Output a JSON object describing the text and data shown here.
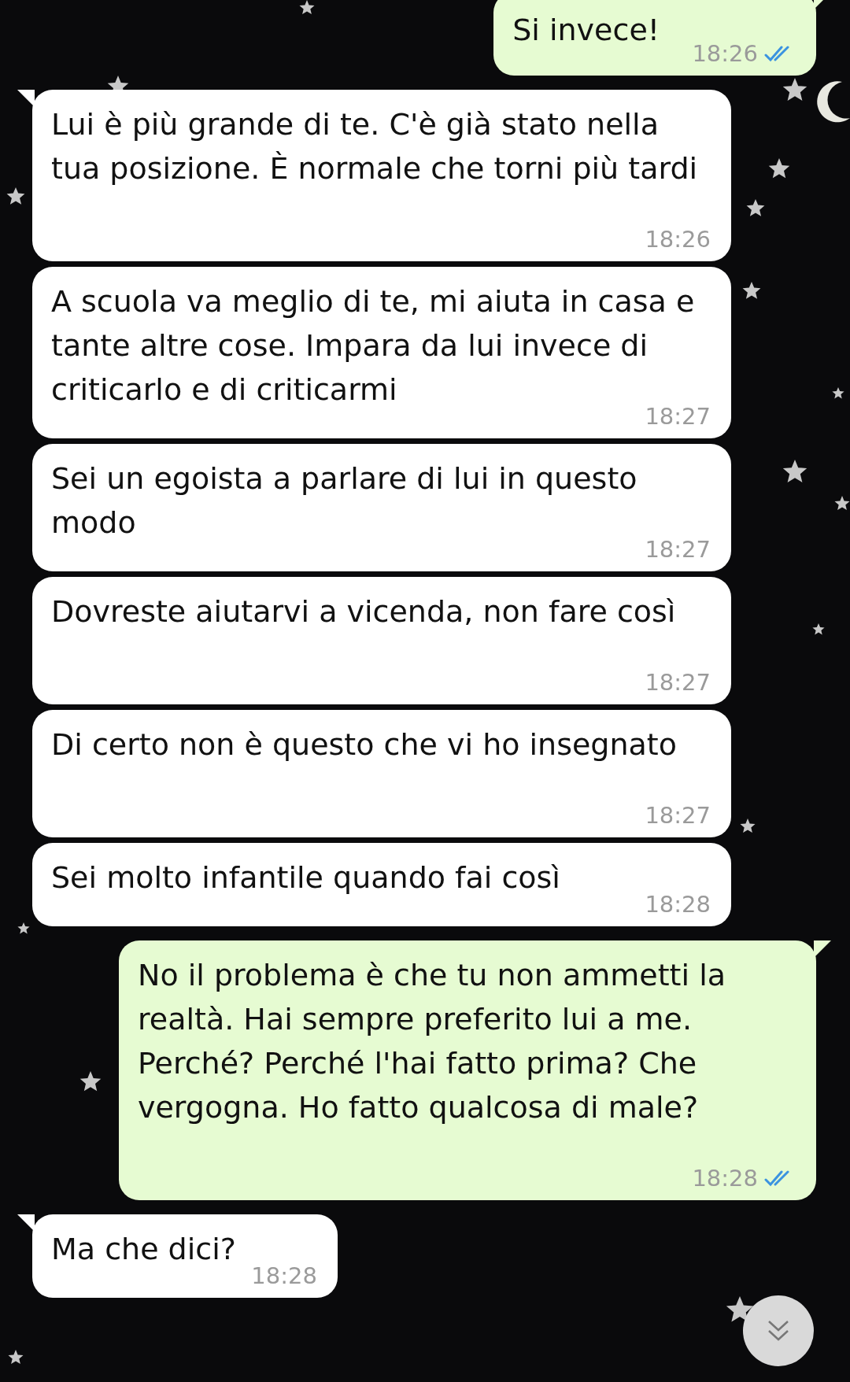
{
  "messages": [
    {
      "kind": "out",
      "text": "Si invece!",
      "time": "18:26",
      "read": true,
      "tail": true
    },
    {
      "kind": "in",
      "text": "Lui è più grande di te. C'è già stato nella tua posizione. È normale che torni più tardi",
      "time": "18:26",
      "tail": true
    },
    {
      "kind": "in",
      "text": "A scuola va meglio di te, mi aiuta in casa e tante altre cose. Impara da lui invece di criticarlo e di criticarmi",
      "time": "18:27",
      "tail": false
    },
    {
      "kind": "in",
      "text": "Sei un egoista a parlare di lui in questo modo",
      "time": "18:27",
      "tail": false
    },
    {
      "kind": "in",
      "text": "Dovreste aiutarvi a vicenda, non fare così",
      "time": "18:27",
      "tail": false
    },
    {
      "kind": "in",
      "text": "Di certo non è questo che vi ho insegnato",
      "time": "18:27",
      "tail": false
    },
    {
      "kind": "in",
      "text": "Sei molto infantile quando fai così",
      "time": "18:28",
      "tail": false
    },
    {
      "kind": "out",
      "text": "No il problema è che tu non ammetti la realtà. Hai sempre preferito lui a me. Perché? Perché l'hai fatto prima? Che vergogna. Ho fatto qualcosa di male?",
      "time": "18:28",
      "read": true,
      "tail": true
    },
    {
      "kind": "in",
      "text": "Ma che dici?",
      "time": "18:28",
      "tail": true
    }
  ]
}
